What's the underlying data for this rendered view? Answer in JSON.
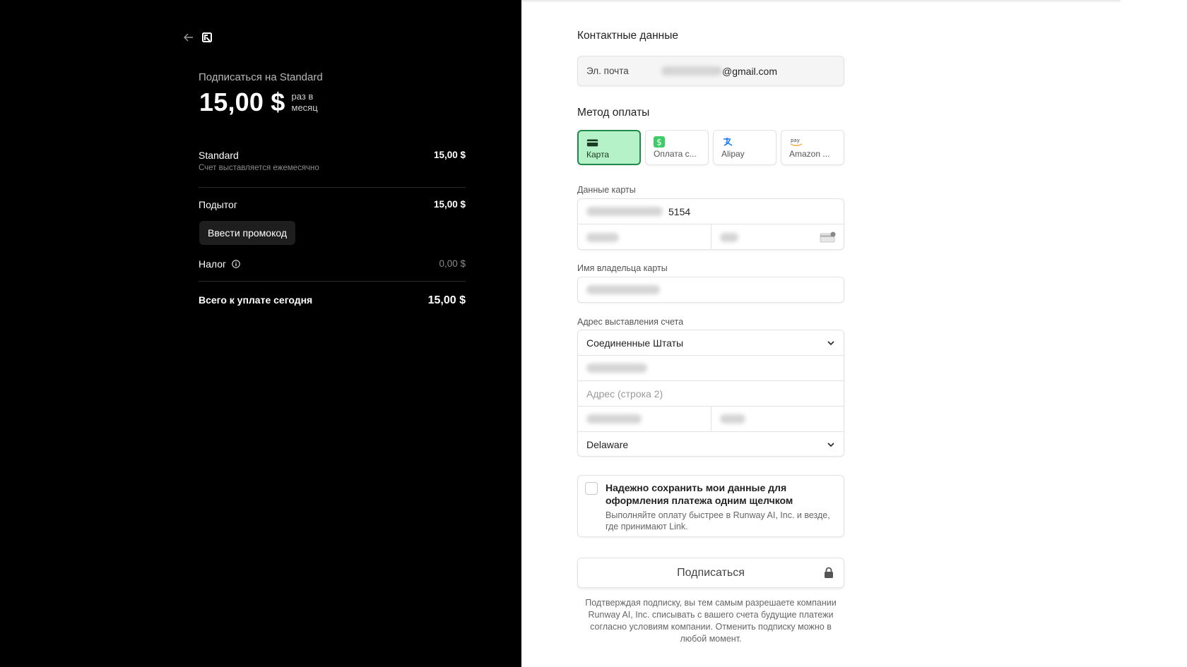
{
  "summary": {
    "subscribe_title": "Подписаться на Standard",
    "price": "15,00 $",
    "period": "раз в месяц",
    "plan_name": "Standard",
    "plan_amount": "15,00 $",
    "plan_billing": "Счет выставляется ежемесячно",
    "subtotal_label": "Подытог",
    "subtotal_amount": "15,00 $",
    "promo_label": "Ввести промокод",
    "tax_label": "Налог",
    "tax_amount": "0,00 $",
    "total_label": "Всего к уплате сегодня",
    "total_amount": "15,00 $"
  },
  "contact": {
    "title": "Контактные данные",
    "email_label": "Эл. почта",
    "email_value": "@gmail.com"
  },
  "payment": {
    "title": "Метод оплаты",
    "methods": [
      {
        "label": "Карта",
        "icon": "card-icon"
      },
      {
        "label": "Оплата с...",
        "icon": "cash-app-icon"
      },
      {
        "label": "Alipay",
        "icon": "alipay-icon"
      },
      {
        "label": "Amazon ...",
        "icon": "amazon-pay-icon"
      }
    ]
  },
  "card": {
    "label": "Данные карты",
    "last4": "5154"
  },
  "holder": {
    "label": "Имя владельца карты"
  },
  "address": {
    "label": "Адрес выставления счета",
    "country": "Соединенные Штаты",
    "line2_placeholder": "Адрес (строка 2)",
    "state": "Delaware"
  },
  "save": {
    "title": "Надежно сохранить мои данные для оформления платежа одним щелчком",
    "description": "Выполняйте оплату быстрее в Runway AI, Inc. и везде, где принимают Link."
  },
  "subscribe_button": "Подписаться",
  "disclaimer": "Подтверждая подписку, вы тем самым разрешаете компании Runway AI, Inc. списывать с вашего счета будущие платежи согласно условиям компании. Отменить подписку можно в любой момент.",
  "colors": {
    "left_bg": "#000000",
    "active_method_bg": "#b6f2c7",
    "active_method_border": "#1f8a4c"
  }
}
